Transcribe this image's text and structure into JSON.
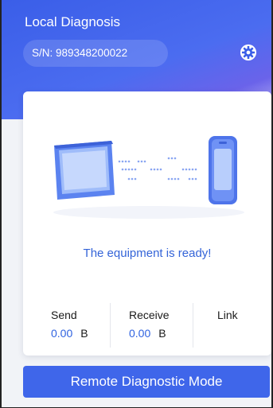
{
  "header": {
    "title": "Local Diagnosis",
    "serial": "S/N: 989348200022",
    "settings_icon": "gear-icon"
  },
  "card": {
    "illustration": "computer-to-device-connection",
    "status": "The equipment is ready!",
    "stats": {
      "send_label": "Send",
      "send_value": "0.00",
      "send_unit": "B",
      "receive_label": "Receive",
      "receive_value": "0.00",
      "receive_unit": "B",
      "link_label": "Link"
    }
  },
  "footer": {
    "remote_button": "Remote Diagnostic Mode"
  },
  "colors": {
    "primary": "#3f66ea",
    "status_text": "#3464d8",
    "value_text": "#2f62e0"
  }
}
